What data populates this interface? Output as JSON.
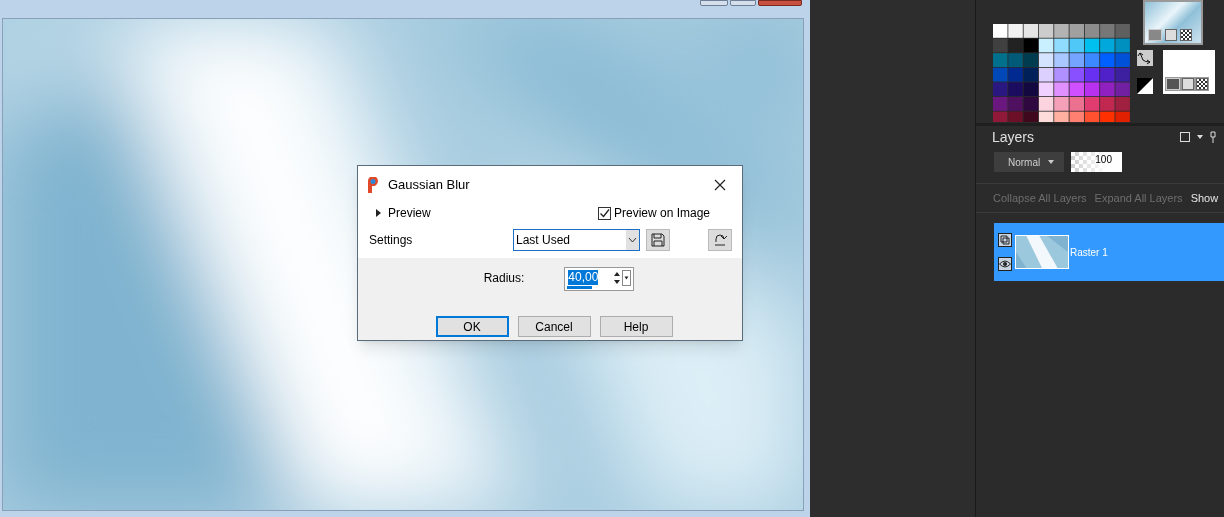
{
  "dialog": {
    "title": "Gaussian Blur",
    "preview_toggle": {
      "label": "Preview",
      "expanded": false
    },
    "preview_on_image": {
      "label": "Preview on Image",
      "checked": true
    },
    "settings": {
      "label": "Settings",
      "value": "Last Used"
    },
    "radius": {
      "label": "Radius:",
      "value": "40,00",
      "level": 0.4
    },
    "buttons": [
      {
        "label": "OK",
        "default": true
      },
      {
        "label": "Cancel",
        "default": false
      },
      {
        "label": "Help",
        "default": false
      }
    ]
  },
  "layers_panel": {
    "title": "Layers",
    "blend_mode": "Normal",
    "opacity": "100",
    "actions": [
      {
        "label": "Collapse All Layers",
        "disabled": true
      },
      {
        "label": "Expand All Layers",
        "disabled": true
      },
      {
        "label": "Show",
        "disabled": false
      }
    ],
    "layers": [
      {
        "name": "Raster 1",
        "selected": true,
        "visible": true
      }
    ]
  }
}
